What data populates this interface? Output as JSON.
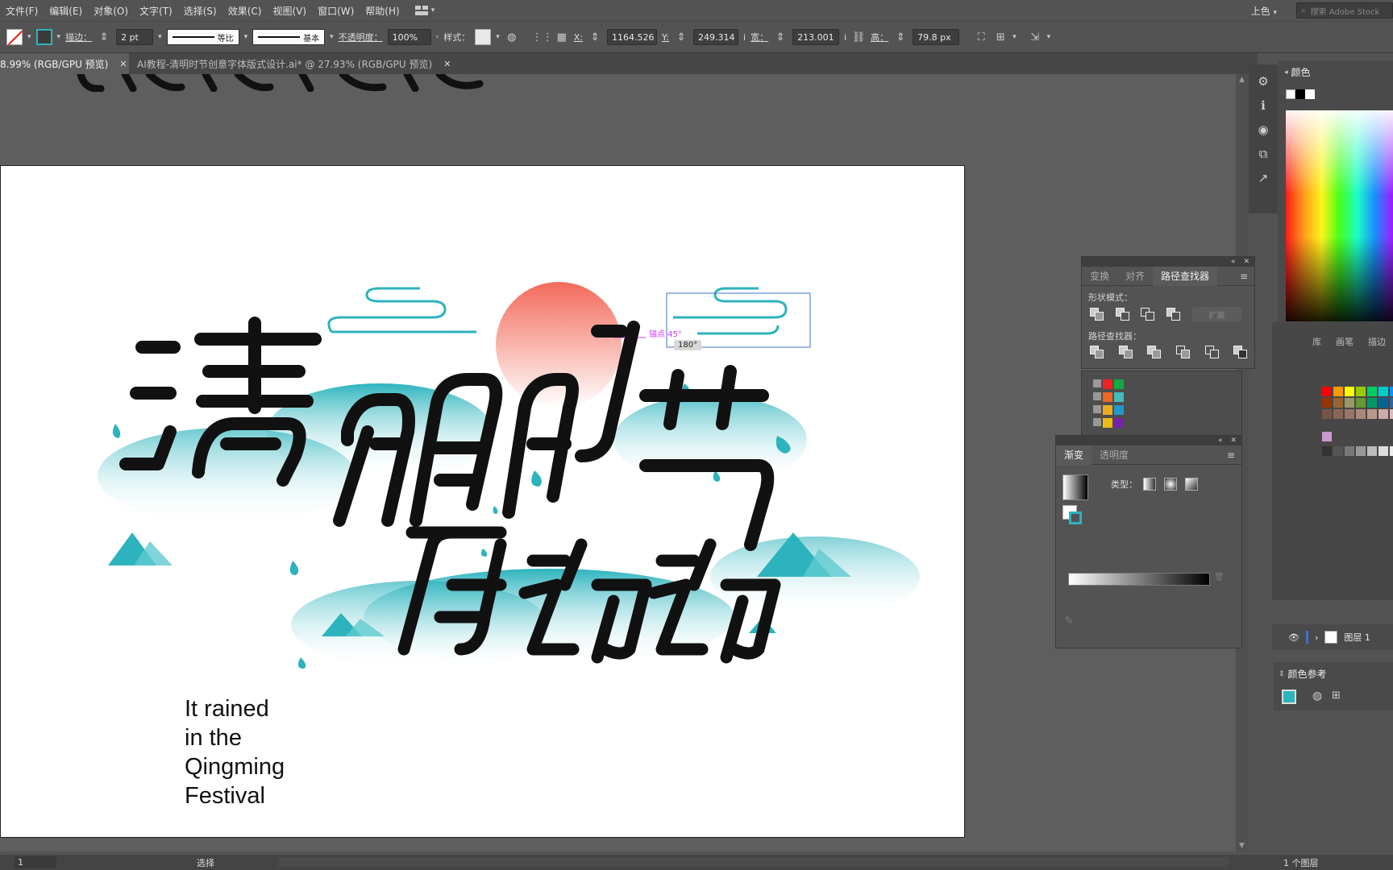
{
  "menu": {
    "items": [
      "文件(F)",
      "编辑(E)",
      "对象(O)",
      "文字(T)",
      "选择(S)",
      "效果(C)",
      "视图(V)",
      "窗口(W)",
      "帮助(H)"
    ],
    "workspace": "上色",
    "search_placeholder": "搜索 Adobe Stock"
  },
  "control": {
    "stroke_label": "描边：",
    "stroke_value": "2 pt",
    "profile_label": "等比",
    "brush_label": "基本",
    "opacity_label": "不透明度：",
    "opacity_value": "100%",
    "style_label": "样式：",
    "x_label": "X:",
    "x_value": "1164.526",
    "y_label": "Y:",
    "y_value": "249.314",
    "unit": "i",
    "w_label": "宽：",
    "w_value": "213.001",
    "h_label": "高：",
    "h_value": "79.8 px"
  },
  "tabs": [
    {
      "label": "8.99% (RGB/GPU 预览)",
      "active": true
    },
    {
      "label": "AI教程-清明时节创意字体版式设计.ai* @ 27.93% (RGB/GPU 预览)",
      "active": false
    }
  ],
  "artwork": {
    "english_lines": [
      "It rained",
      "in the",
      "Qingming",
      "Festival"
    ],
    "smart_guide": "锚点 45°",
    "rotation_tip": "180°"
  },
  "panels": {
    "color": {
      "title": "颜色"
    },
    "pathfinder": {
      "tabs": [
        "变换",
        "对齐",
        "路径查找器"
      ],
      "shape_modes_label": "形状模式：",
      "expand_label": "扩展",
      "pathfinders_label": "路径查找器："
    },
    "gradient": {
      "tabs": [
        "渐变",
        "透明度"
      ],
      "type_label": "类型："
    },
    "swatches": {
      "tabs": [
        "库",
        "画笔",
        "描边"
      ]
    },
    "layers": {
      "layer_name": "图层 1"
    },
    "color_guide": {
      "title": "颜色参考"
    }
  },
  "status": {
    "zoom": "1",
    "tool": "选择",
    "layers_count": "1 个图层"
  },
  "colors": {
    "teal": "#2cb3bd",
    "sun": "#f26a5a",
    "ink": "#111111",
    "ui_bg": "#535353"
  }
}
